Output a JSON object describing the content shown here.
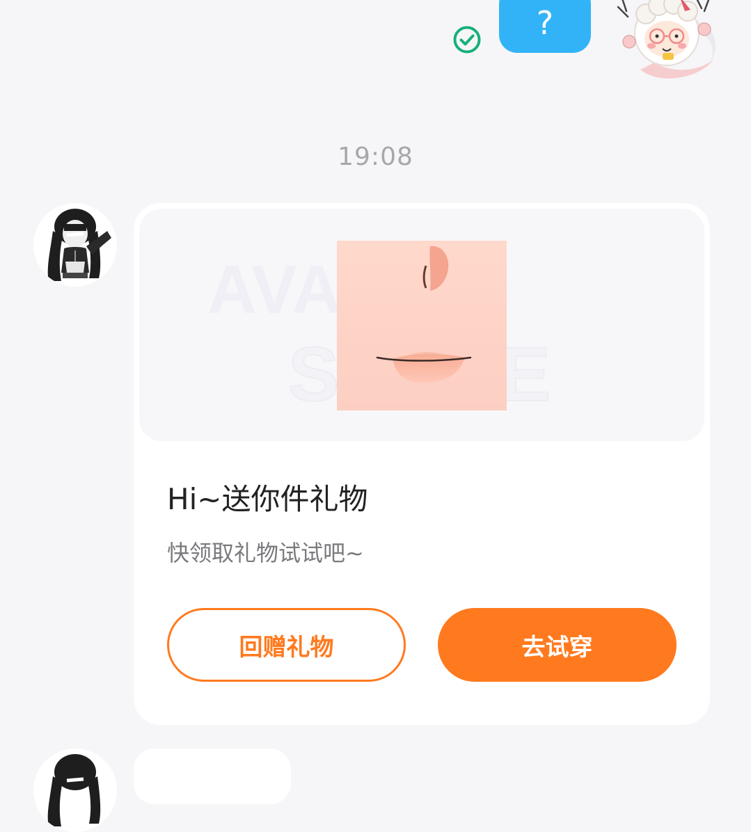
{
  "sent_message": {
    "text": "?",
    "status_icon": "check-circle-icon",
    "status_color": "#16b07a",
    "bubble_color": "#33b3f7"
  },
  "timestamp": "19:08",
  "gift_card": {
    "watermark_line1": "AVATAR",
    "watermark_line2": "STORE",
    "title": "Hi~送你件礼物",
    "subtitle": "快领取礼物试试吧~",
    "return_gift_label": "回赠礼物",
    "try_on_label": "去试穿",
    "accent_color": "#ff7a1e"
  }
}
